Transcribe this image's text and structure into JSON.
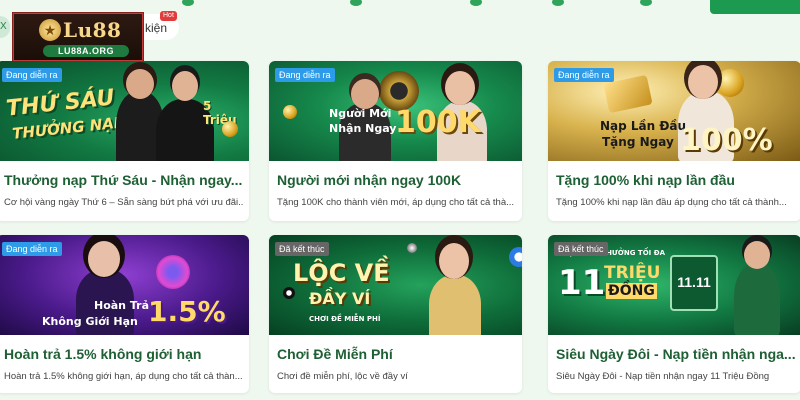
{
  "header": {
    "logo_brand": "Lu88",
    "logo_url": "LU88A.ORG",
    "tab_partial_label": "kiện",
    "hot_badge": "Hot",
    "left_pill": "X"
  },
  "colors": {
    "brand_green": "#1e5f34",
    "status_active": "#2e9be8",
    "status_ended": "#666666"
  },
  "cards": [
    {
      "status": "Đang diễn ra",
      "banner_text": [
        "THỨ SÁU",
        "THƯỞNG NẠP",
        "5 Triệu"
      ],
      "title": "Thưởng nạp Thứ Sáu - Nhận ngay...",
      "description": "Cơ hội vàng ngày Thứ 6 – Sẵn sàng bứt phá với ưu đãi..."
    },
    {
      "status": "Đang diễn ra",
      "banner_text": [
        "Người Mới",
        "Nhận Ngay",
        "100K"
      ],
      "title": "Người mới nhận ngay 100K",
      "description": "Tặng 100K cho thành viên mới, áp dụng cho tất cả thà..."
    },
    {
      "status": "Đang diễn ra",
      "banner_text": [
        "Nạp Lần Đầu",
        "Tặng Ngay",
        "100%"
      ],
      "title": "Tặng 100% khi nạp lần đầu",
      "description": "Tặng 100% khi nạp lần đầu áp dụng cho tất cả thành..."
    },
    {
      "status": "Đang diễn ra",
      "banner_text": [
        "Hoàn Trả",
        "Không Giới Hạn",
        "1.5%"
      ],
      "title": "Hoàn trả 1.5% không giới hạn",
      "description": "Hoàn trả 1.5% không giới hạn, áp dụng cho tất cả thàn..."
    },
    {
      "status": "Đã kết thúc",
      "banner_text": [
        "LỘC VỀ",
        "ĐẦY VÍ",
        "CHƠI ĐỀ MIỄN PHÍ"
      ],
      "title": "Chơi Đề Miễn Phí",
      "description": "Chơi đề miễn phí, lộc về đầy ví"
    },
    {
      "status": "Đã kết thúc",
      "banner_text": [
        "NẠP TIỀN THƯỞNG TỐI ĐA",
        "11",
        "TRIỆU",
        "ĐỒNG",
        "11.11"
      ],
      "title": "Siêu Ngày Đôi - Nạp tiền nhận nga...",
      "description": "Siêu Ngày Đôi - Nạp tiền nhận ngay 11 Triệu Đồng"
    }
  ]
}
